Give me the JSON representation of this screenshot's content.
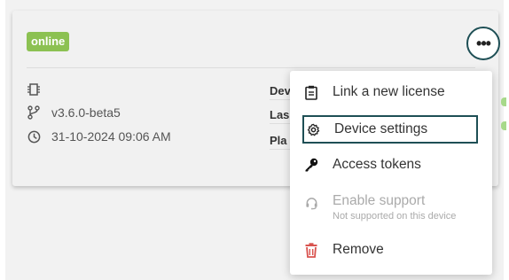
{
  "device": {
    "status": "online",
    "version": "v3.6.0-beta5",
    "date": "31-10-2024 09:06 AM",
    "detail_labels": [
      "Dev",
      "Las",
      "Pla"
    ]
  },
  "more_button": {
    "glyph": "•••"
  },
  "menu": {
    "items": [
      {
        "label": "Link a new license",
        "icon": "clipboard-icon"
      },
      {
        "label": "Device settings",
        "icon": "gear-icon"
      },
      {
        "label": "Access tokens",
        "icon": "key-icon"
      },
      {
        "label": "Enable support",
        "sublabel": "Not supported on this device",
        "icon": "support-headset-icon"
      },
      {
        "label": "Remove",
        "icon": "trash-icon"
      }
    ]
  },
  "colors": {
    "online": "#8cc152",
    "focus_border": "#1e4f55",
    "remove_icon": "#d9534f"
  }
}
